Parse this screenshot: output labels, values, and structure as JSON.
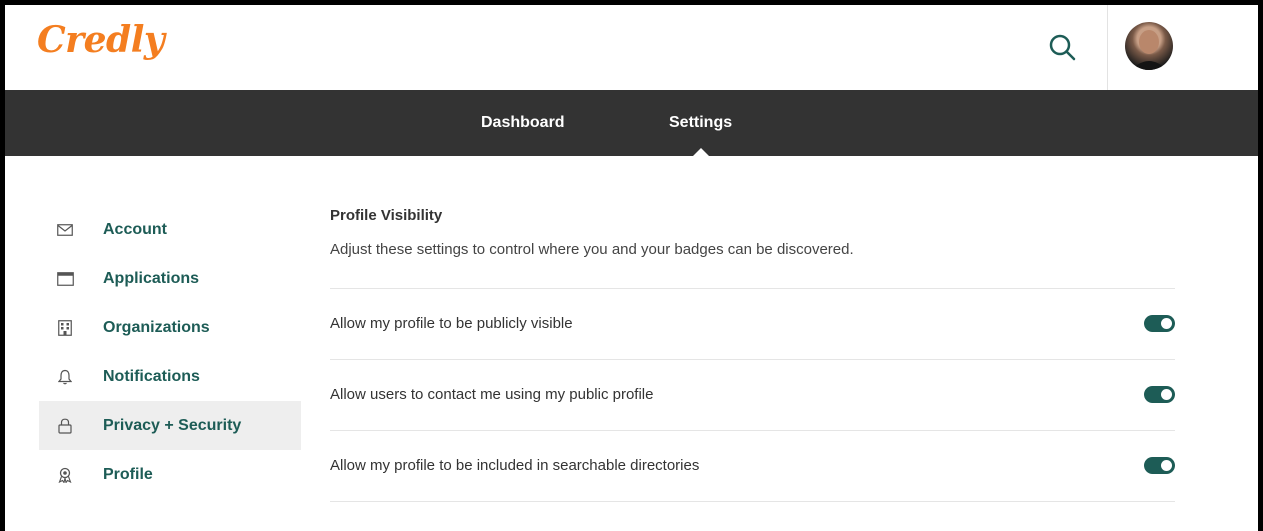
{
  "header": {
    "logo_text": "Credly",
    "search_icon": "search-icon",
    "avatar": "user-avatar"
  },
  "nav": {
    "tabs": [
      {
        "label": "Dashboard",
        "active": false
      },
      {
        "label": "Settings",
        "active": true
      }
    ]
  },
  "sidebar": {
    "items": [
      {
        "label": "Account",
        "icon": "mail-icon",
        "active": false
      },
      {
        "label": "Applications",
        "icon": "window-icon",
        "active": false
      },
      {
        "label": "Organizations",
        "icon": "building-icon",
        "active": false
      },
      {
        "label": "Notifications",
        "icon": "bell-icon",
        "active": false
      },
      {
        "label": "Privacy + Security",
        "icon": "lock-icon",
        "active": true
      },
      {
        "label": "Profile",
        "icon": "badge-icon",
        "active": false
      }
    ]
  },
  "main": {
    "title": "Profile Visibility",
    "description": "Adjust these settings to control where you and your badges can be discovered.",
    "settings": [
      {
        "label": "Allow my profile to be publicly visible",
        "enabled": true
      },
      {
        "label": "Allow users to contact me using my public profile",
        "enabled": true
      },
      {
        "label": "Allow my profile to be included in searchable directories",
        "enabled": true
      }
    ]
  },
  "colors": {
    "brand_orange": "#f47e20",
    "accent_teal": "#1d5c56",
    "navbar": "#333333"
  }
}
